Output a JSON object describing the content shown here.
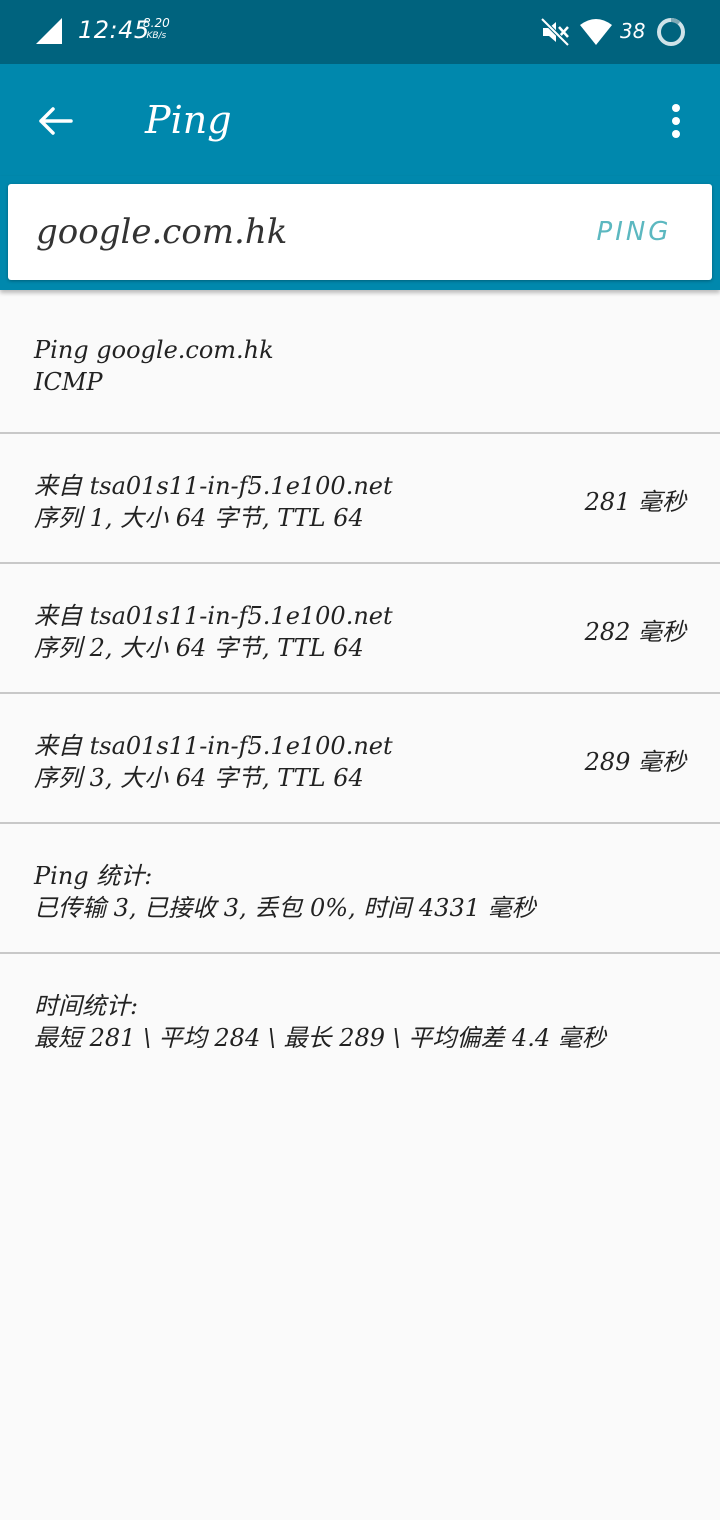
{
  "status_bar": {
    "time": "12:45",
    "net_rate": "8.20",
    "net_unit": "KB/s",
    "battery": "38",
    "icons": [
      "signal-icon",
      "mute-icon",
      "wifi-icon",
      "battery-ring-icon"
    ]
  },
  "app_bar": {
    "title": "Ping",
    "icons": [
      "back-arrow-icon",
      "more-vert-icon"
    ]
  },
  "search": {
    "value": "google.com.hk",
    "button_label": "PING"
  },
  "results": {
    "header": {
      "line1": "Ping google.com.hk",
      "line2": "ICMP"
    },
    "replies": [
      {
        "from": "来自 tsa01s11-in-f5.1e100.net",
        "detail": "序列 1, 大小 64 字节, TTL 64",
        "time": "281 毫秒"
      },
      {
        "from": "来自 tsa01s11-in-f5.1e100.net",
        "detail": "序列 2, 大小 64 字节, TTL 64",
        "time": "282 毫秒"
      },
      {
        "from": "来自 tsa01s11-in-f5.1e100.net",
        "detail": "序列 3, 大小 64 字节, TTL 64",
        "time": "289 毫秒"
      }
    ],
    "ping_stats": {
      "line1": "Ping 统计:",
      "line2": "已传输 3, 已接收 3, 丢包 0%, 时间 4331 毫秒"
    },
    "time_stats": {
      "line1": "时间统计:",
      "line2": "最短 281 \\ 平均 284 \\ 最长 289 \\ 平均偏差 4.4 毫秒"
    }
  },
  "colors": {
    "status_bar": "#00637e",
    "app_bar": "#0088ad",
    "accent_button": "#5cb8c0",
    "background": "#fafafa",
    "divider": "#c8c8c8"
  }
}
